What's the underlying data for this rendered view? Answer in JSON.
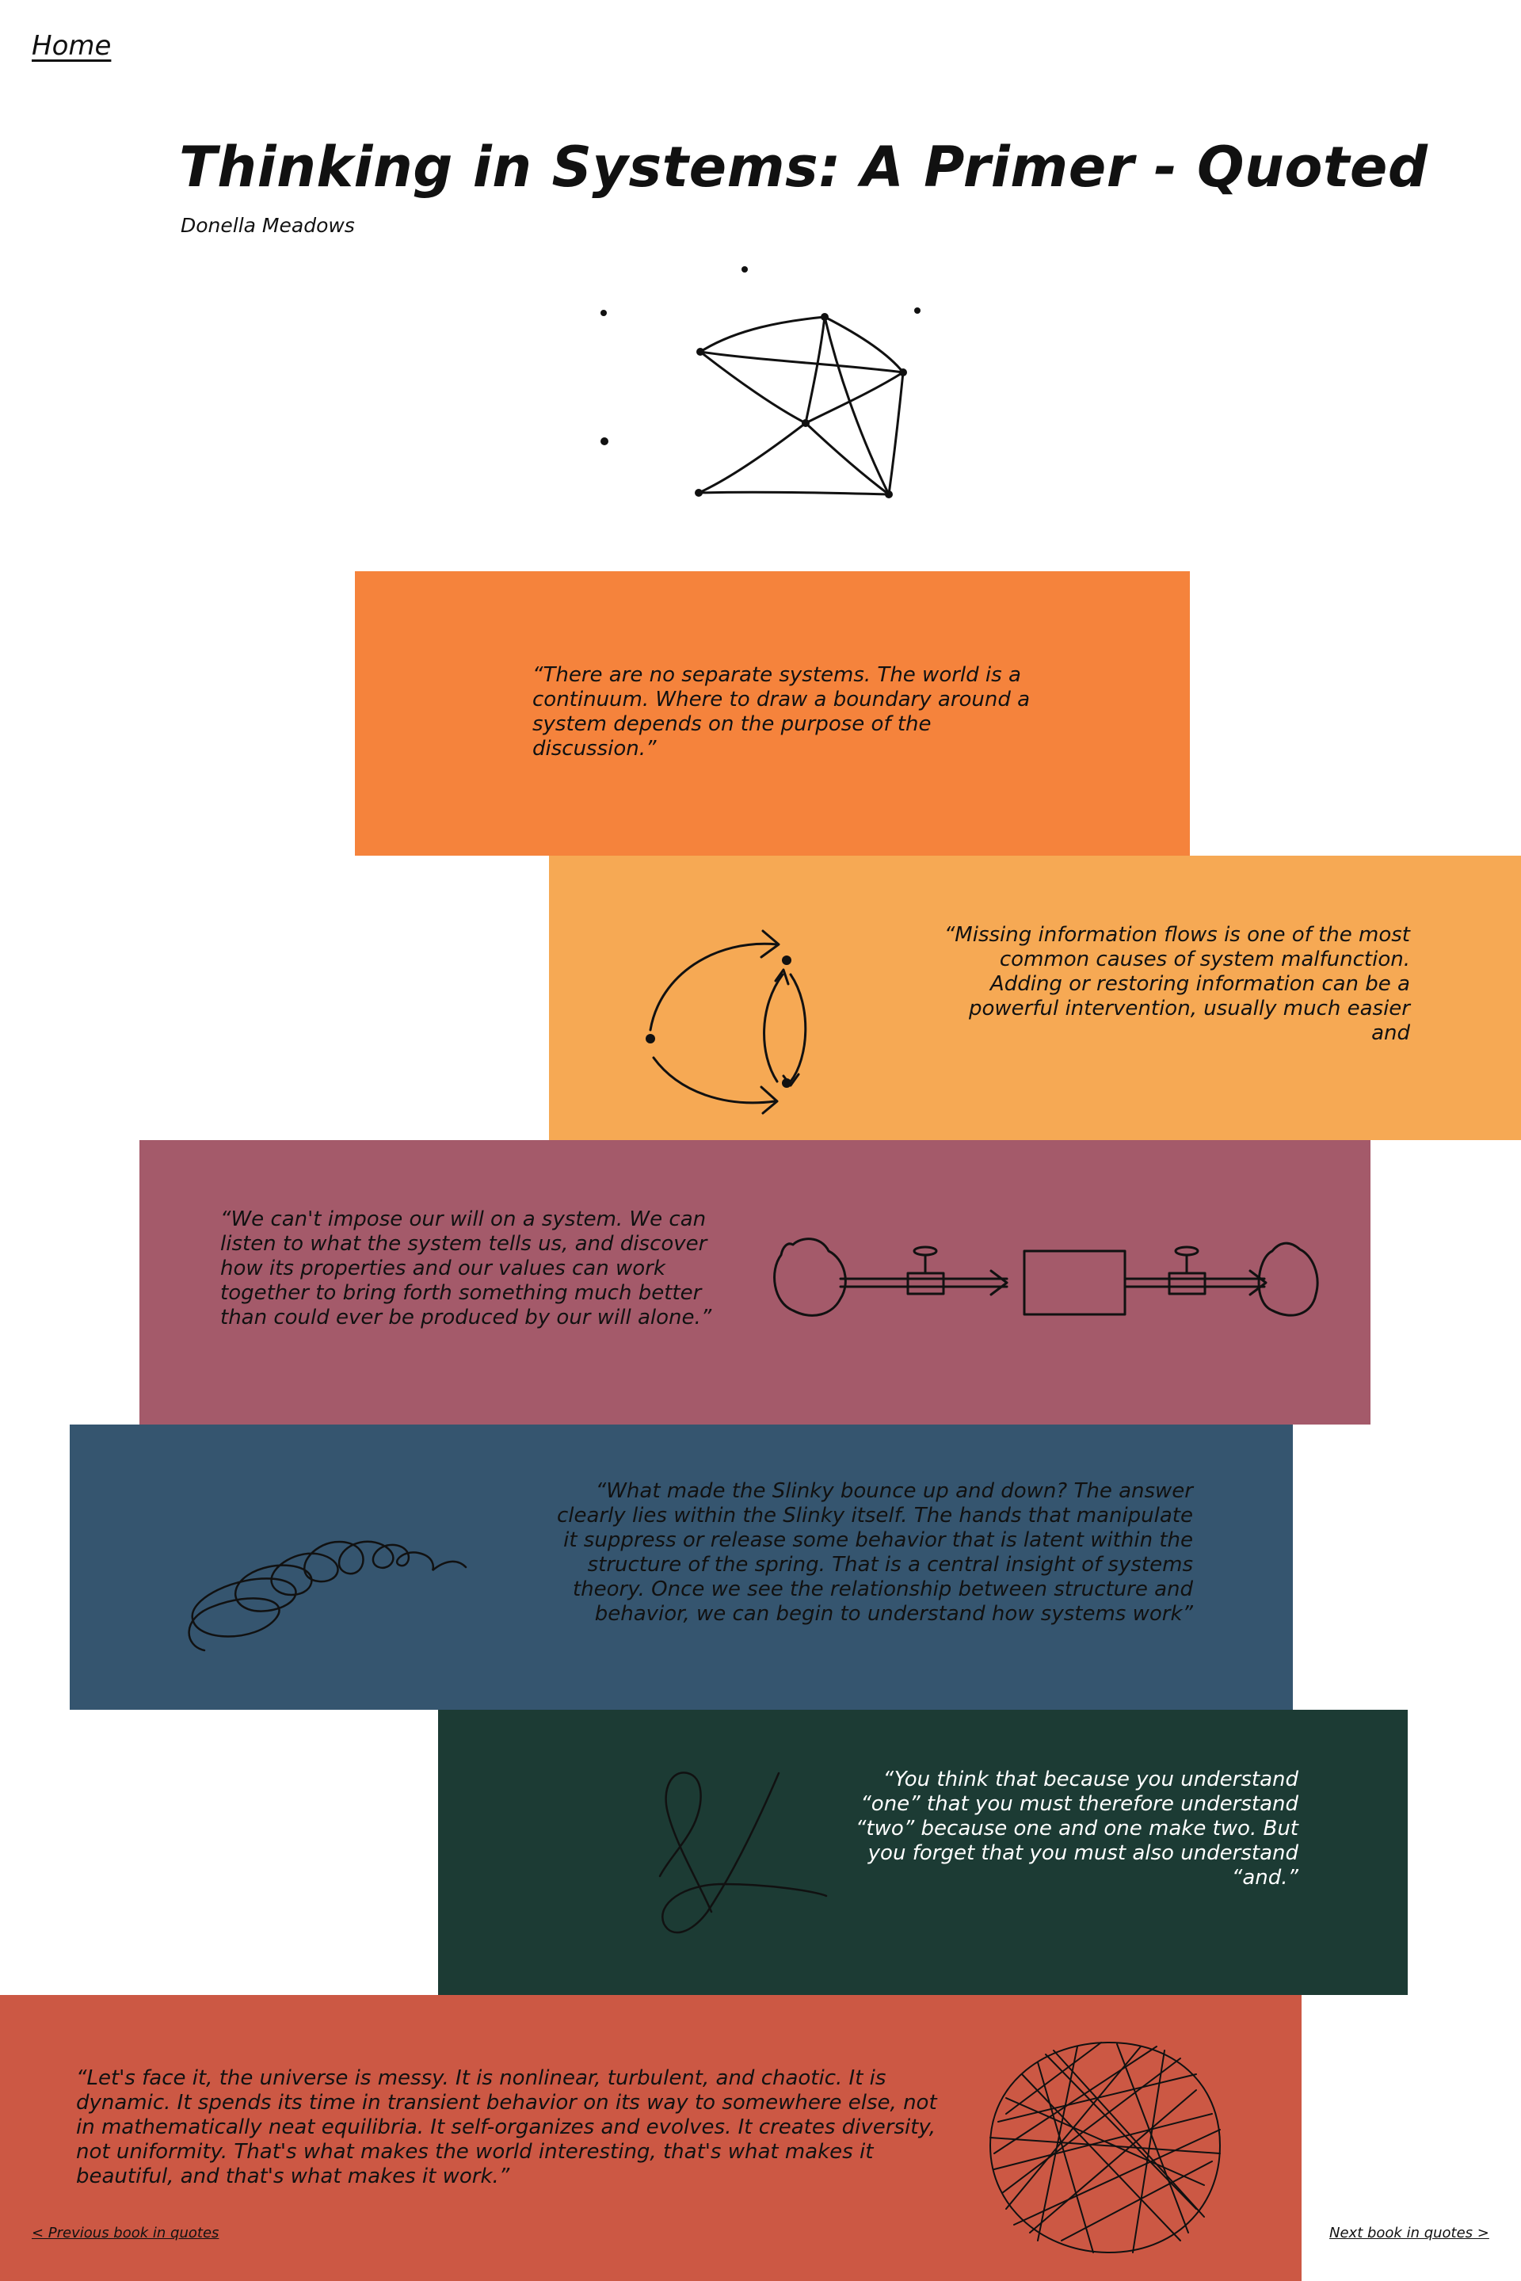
{
  "nav": {
    "home_label": "Home",
    "prev_label": "< Previous book in quotes",
    "next_label": "Next book in quotes >"
  },
  "header": {
    "title": "Thinking in Systems: A Primer - Quoted",
    "author": "Donella Meadows"
  },
  "cards": [
    {
      "color": "#f5833c",
      "quote": "“There are no separate systems. The world is a continuum. Where to draw a boundary around a system depends on the purpose of the discussion.”"
    },
    {
      "color": "#f6a954",
      "quote": "“Missing information flows is one of the most common causes of system malfunction. Adding or restoring information can be a powerful intervention, usually much easier and",
      "art": "cycle-arrows-icon"
    },
    {
      "color": "#a45a6a",
      "quote": "“We can't impose our will on a system. We can listen to what the system tells us, and discover how its properties and our values can work together to bring forth something much better than could ever be produced by our will alone.”",
      "art": "stock-flow-diagram-icon"
    },
    {
      "color": "#35556f",
      "quote": "“What made the Slinky bounce up and down? The answer clearly lies within the Slinky itself. The hands that manipulate it suppress or release some behavior that is latent within the structure of the spring. That is a central insight of systems theory. Once we see the relationship between structure and behavior, we can begin to understand how systems work”",
      "art": "slinky-spring-icon"
    },
    {
      "color": "#1c3b34",
      "quote": "“You think that because you understand “one” that you must therefore understand “two” because one and one make two. But you forget that you must also understand “and.”",
      "art": "ampersand-icon"
    },
    {
      "color": "#cc5844",
      "quote": "“Let's face it, the universe is messy. It is nonlinear, turbulent, and chaotic. It is dynamic. It spends its time in transient behavior on its way to somewhere else, not in mathematically neat equilibria. It self-organizes and evolves. It creates diversity, not uniformity. That's what makes the world interesting, that's what makes it beautiful, and that's what makes it work.”",
      "art": "tangled-sphere-icon"
    }
  ]
}
